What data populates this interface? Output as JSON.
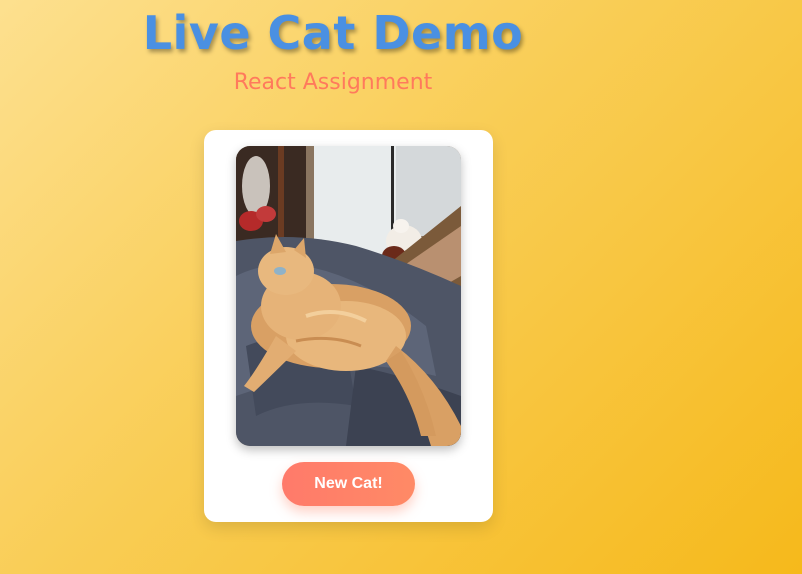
{
  "header": {
    "title": "Live Cat Demo",
    "subtitle": "React Assignment"
  },
  "card": {
    "image": {
      "subject": "orange-long-haired-cat-on-bed",
      "alt": ""
    },
    "button_label": "New Cat!"
  },
  "colors": {
    "title": "#4a90e2",
    "subtitle": "#ff7a5c",
    "button": "#ff7a6a",
    "background_start": "#fde08f",
    "background_end": "#f6b91b"
  }
}
